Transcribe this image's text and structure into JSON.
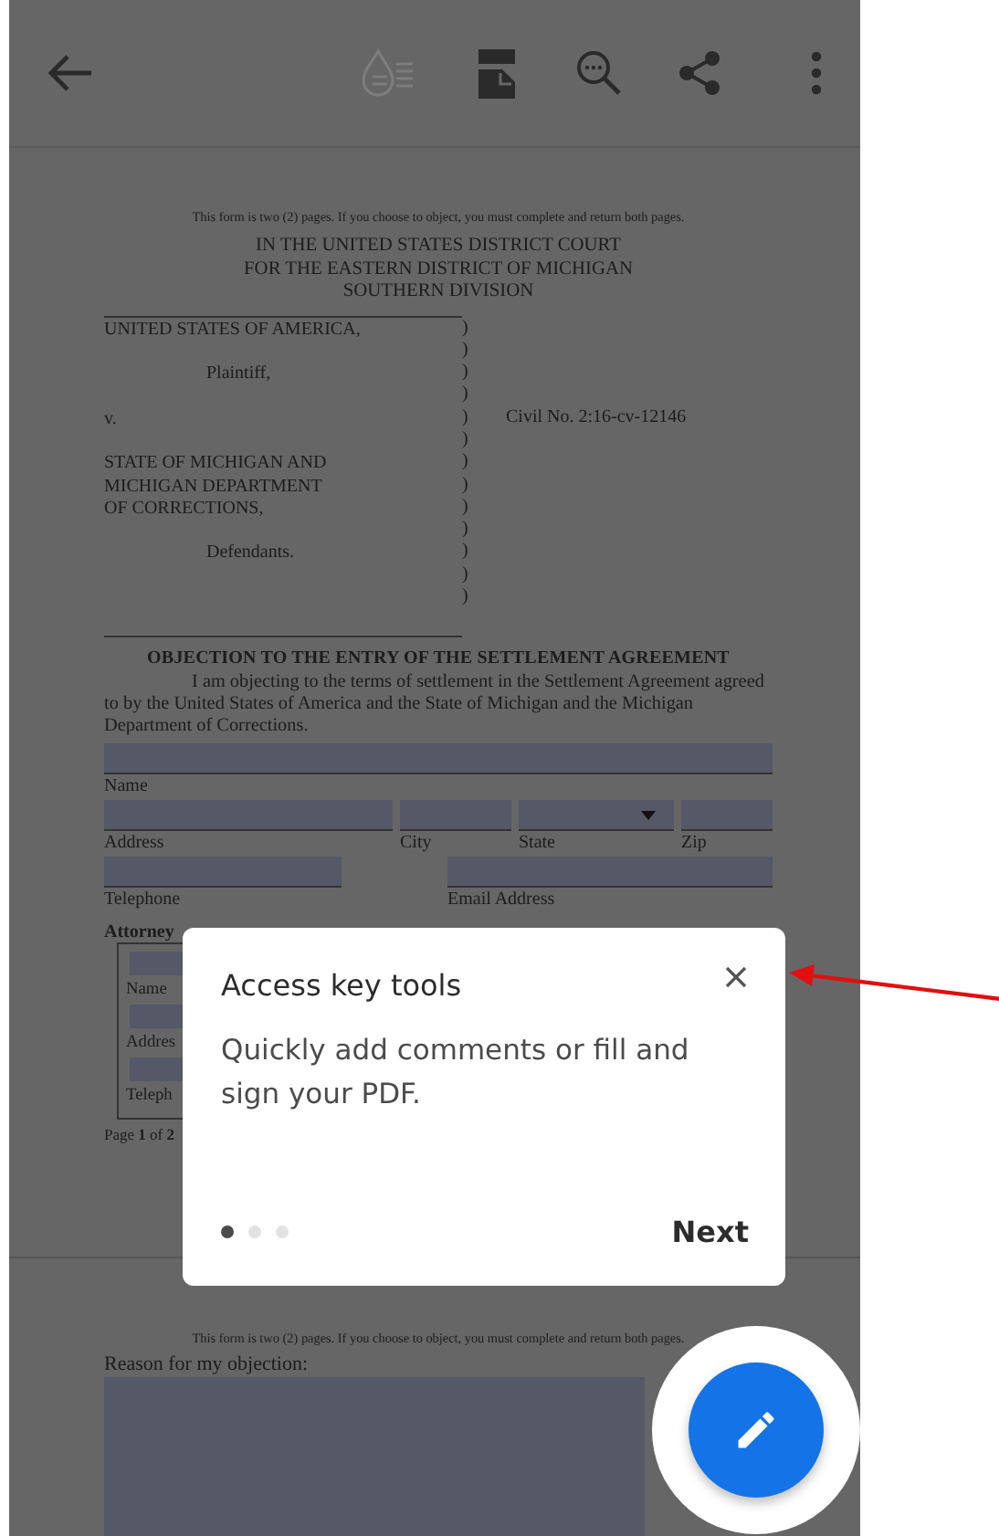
{
  "toolbar": {
    "tools": [
      {
        "kind": "back",
        "disabled": false
      },
      {
        "kind": "liquid",
        "disabled": true
      },
      {
        "kind": "page",
        "disabled": false
      },
      {
        "kind": "search",
        "disabled": false
      },
      {
        "kind": "share",
        "disabled": false
      },
      {
        "kind": "more",
        "disabled": false
      }
    ]
  },
  "page_1": {
    "notice": "This form is two (2) pages. If you choose to object, you must complete and return both pages.",
    "court": [
      "IN THE UNITED STATES DISTRICT COURT",
      "FOR THE EASTERN DISTRICT OF MICHIGAN",
      "SOUTHERN DIVISION"
    ],
    "caption": [
      {
        "kind": "party",
        "text": "UNITED STATES OF AMERICA,"
      },
      {
        "kind": "role",
        "text": "Plaintiff,"
      },
      {
        "kind": "versus",
        "text": "v."
      },
      {
        "kind": "party",
        "text": "STATE OF MICHIGAN AND"
      },
      {
        "kind": "party",
        "text": "MICHIGAN DEPARTMENT"
      },
      {
        "kind": "party",
        "text": "OF CORRECTIONS,"
      },
      {
        "kind": "role",
        "text": "Defendants."
      }
    ],
    "brackets": [
      ")",
      ")",
      ")",
      ")",
      ")",
      ")",
      ")",
      ")",
      ")",
      ")",
      ")",
      ")",
      ")"
    ],
    "civil_no": "Civil No. 2:16-cv-12146",
    "heading": "OBJECTION TO THE ENTRY OF THE SETTLEMENT AGREEMENT",
    "paragraph": "I am objecting to the terms of settlement in the Settlement Agreement agreed to by the United States of America and the State of Michigan and the Michigan Department of Corrections.",
    "form_rows": [
      {
        "fields": [
          {
            "kind": "text",
            "label": "Name"
          }
        ]
      },
      {
        "fields": [
          {
            "kind": "text",
            "label": "Address"
          },
          {
            "kind": "text",
            "label": "City"
          },
          {
            "kind": "dropdown",
            "label": "State"
          },
          {
            "kind": "text",
            "label": "Zip"
          }
        ]
      },
      {
        "fields": [
          {
            "kind": "text",
            "label": "Telephone"
          },
          {
            "kind": "text",
            "label": "Email Address"
          }
        ]
      }
    ],
    "attorney_label": "Attorney",
    "attorney_fields": [
      "Name",
      "Addres",
      "Teleph"
    ],
    "footer": "Page **1** of **2**"
  },
  "page_2": {
    "notice": "This form is two (2) pages. If you choose to object, you must complete and return both pages.",
    "reason_label": "Reason for my objection:"
  },
  "tooltip": {
    "title": "Access key tools",
    "body": "Quickly add comments or fill and sign your PDF.",
    "pages": [
      {
        "selected": true
      },
      {
        "selected": false
      },
      {
        "selected": false
      }
    ],
    "next": "Next"
  }
}
